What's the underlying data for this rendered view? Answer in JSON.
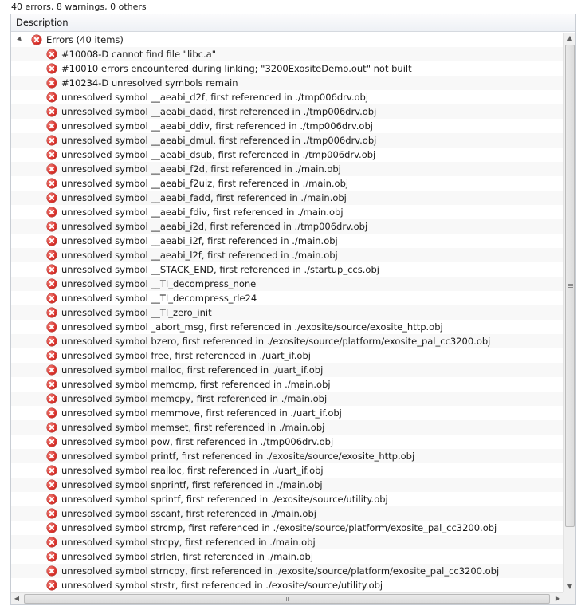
{
  "summary": "40 errors, 8 warnings, 0 others",
  "table": {
    "column_header": "Description",
    "group": {
      "label": "Errors (40 items)",
      "icon": "error-icon"
    },
    "items": [
      "#10008-D cannot find file \"libc.a\"",
      "#10010 errors encountered during linking; \"3200ExositeDemo.out\" not built",
      "#10234-D unresolved symbols remain",
      "unresolved symbol __aeabi_d2f, first referenced in ./tmp006drv.obj",
      "unresolved symbol __aeabi_dadd, first referenced in ./tmp006drv.obj",
      "unresolved symbol __aeabi_ddiv, first referenced in ./tmp006drv.obj",
      "unresolved symbol __aeabi_dmul, first referenced in ./tmp006drv.obj",
      "unresolved symbol __aeabi_dsub, first referenced in ./tmp006drv.obj",
      "unresolved symbol __aeabi_f2d, first referenced in ./main.obj",
      "unresolved symbol __aeabi_f2uiz, first referenced in ./main.obj",
      "unresolved symbol __aeabi_fadd, first referenced in ./main.obj",
      "unresolved symbol __aeabi_fdiv, first referenced in ./main.obj",
      "unresolved symbol __aeabi_i2d, first referenced in ./tmp006drv.obj",
      "unresolved symbol __aeabi_i2f, first referenced in ./main.obj",
      "unresolved symbol __aeabi_l2f, first referenced in ./main.obj",
      "unresolved symbol __STACK_END, first referenced in ./startup_ccs.obj",
      "unresolved symbol __TI_decompress_none",
      "unresolved symbol __TI_decompress_rle24",
      "unresolved symbol __TI_zero_init",
      "unresolved symbol _abort_msg, first referenced in ./exosite/source/exosite_http.obj",
      "unresolved symbol bzero, first referenced in ./exosite/source/platform/exosite_pal_cc3200.obj",
      "unresolved symbol free, first referenced in ./uart_if.obj",
      "unresolved symbol malloc, first referenced in ./uart_if.obj",
      "unresolved symbol memcmp, first referenced in ./main.obj",
      "unresolved symbol memcpy, first referenced in ./main.obj",
      "unresolved symbol memmove, first referenced in ./uart_if.obj",
      "unresolved symbol memset, first referenced in ./main.obj",
      "unresolved symbol pow, first referenced in ./tmp006drv.obj",
      "unresolved symbol printf, first referenced in ./exosite/source/exosite_http.obj",
      "unresolved symbol realloc, first referenced in ./uart_if.obj",
      "unresolved symbol snprintf, first referenced in ./main.obj",
      "unresolved symbol sprintf, first referenced in ./exosite/source/utility.obj",
      "unresolved symbol sscanf, first referenced in ./main.obj",
      "unresolved symbol strcmp, first referenced in ./exosite/source/platform/exosite_pal_cc3200.obj",
      "unresolved symbol strcpy, first referenced in ./main.obj",
      "unresolved symbol strlen, first referenced in ./main.obj",
      "unresolved symbol strncpy, first referenced in ./exosite/source/platform/exosite_pal_cc3200.obj",
      "unresolved symbol strstr, first referenced in ./exosite/source/utility.obj"
    ]
  },
  "scrollbars": {
    "up_arrow": "▲",
    "down_arrow": "▼",
    "left_arrow": "◀",
    "right_arrow": "▶"
  }
}
